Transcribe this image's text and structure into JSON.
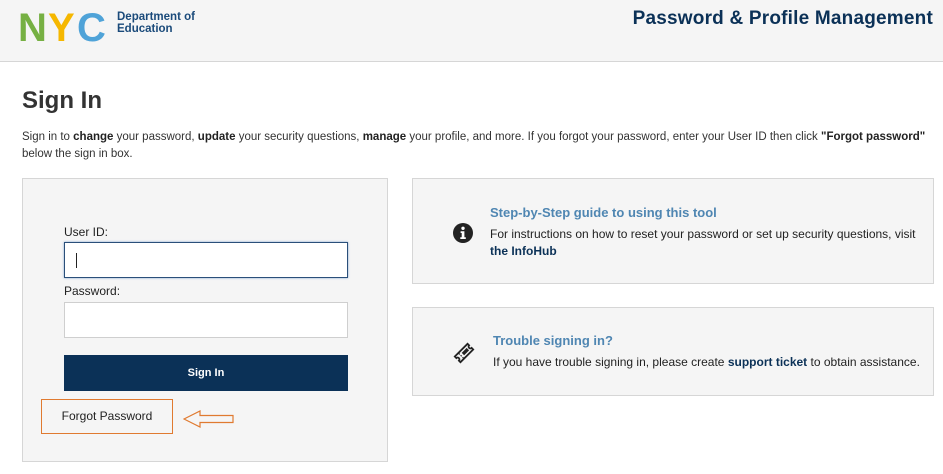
{
  "header": {
    "logo_text": "NYC",
    "org_line1": "Department of",
    "org_line2": "Education",
    "app_title": "Password & Profile Management",
    "logo_colors": {
      "n": "#76b043",
      "y": "#f5b700",
      "c": "#4fa3d8"
    }
  },
  "page": {
    "title": "Sign In",
    "intro": {
      "p1": "Sign in to ",
      "b1": "change",
      "p2": " your password, ",
      "b2": "update",
      "p3": " your security questions, ",
      "b3": "manage",
      "p4": " your profile, and more. If you forgot your password, enter your User ID then click ",
      "b4": "\"Forgot password\"",
      "p5": " below the sign in box."
    }
  },
  "signin": {
    "user_id_label": "User ID:",
    "user_id_value": "",
    "password_label": "Password:",
    "password_value": "",
    "button_label": "Sign In",
    "forgot_label": "Forgot Password"
  },
  "cards": {
    "guide": {
      "icon": "info-icon",
      "title": "Step-by-Step guide to using this tool",
      "body": "For instructions on how to reset your password or set up security questions, visit ",
      "link": "the InfoHub"
    },
    "trouble": {
      "icon": "ticket-icon",
      "title": "Trouble signing in?",
      "body_before": "If you have trouble signing in, please create ",
      "link": "support ticket",
      "body_after": " to obtain assistance."
    }
  },
  "colors": {
    "brand_navy": "#0b3157",
    "link_blue": "#4f86b2",
    "annotation_orange": "#e07a30"
  }
}
